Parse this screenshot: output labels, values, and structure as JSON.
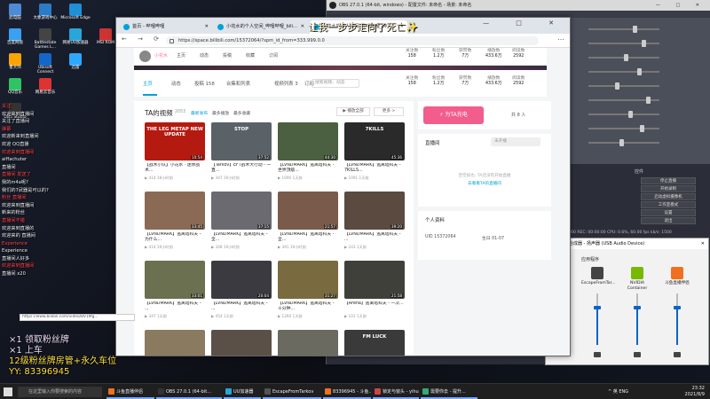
{
  "desktop": {
    "icons": [
      {
        "label": "此电脑",
        "color": "#4c8bd6"
      },
      {
        "label": "大象游戏中心",
        "color": "#2a7cc7"
      },
      {
        "label": "Microsoft Edge",
        "color": "#1f8fd6"
      },
      {
        "label": "百度网盘",
        "color": "#3aa0f0"
      },
      {
        "label": "Battlestate Games L...",
        "color": "#444"
      },
      {
        "label": "网易UU加速器",
        "color": "#2aa5d8"
      },
      {
        "label": "MSI ROM",
        "color": "#c33"
      },
      {
        "label": "鲁大师",
        "color": "#f9a400"
      },
      {
        "label": "Ubisoft Connect",
        "color": "#1467c9"
      },
      {
        "label": "迅雷",
        "color": "#2ca9ff"
      },
      {
        "label": "QQ音乐",
        "color": "#30c363"
      },
      {
        "label": "网易云音乐",
        "color": "#d33"
      },
      {
        "label": "OBS Studio",
        "color": "#333"
      }
    ]
  },
  "chat_overlay": {
    "lines": [
      "关注",
      "欢迎来到直播间",
      "关注了直播间",
      "弹幕",
      "欢迎新来到直播间",
      "欢迎 QQ直播",
      "欢迎来到直播间",
      "aiffachuter",
      "直播间",
      "直播间 发送了",
      "我的m4a呢?",
      "我们的7武器是可以的?",
      "粉丝 直播间",
      "欢迎来到直播间",
      "新来的粉丝",
      "直播间不错",
      "欢迎来到直播的",
      "欢迎来的 直播间",
      "Experience",
      "Experience",
      "直播间人好多",
      "欢迎来到直播间",
      "直播间 x20"
    ]
  },
  "stream_overlay": {
    "line1": "×1 领取粉丝牌",
    "line2": "×1 上车",
    "line3": "12级粉丝牌房管+永久车位",
    "line4": "YY: 83396945",
    "top_text": "让我一步步走向了死亡✨"
  },
  "obs": {
    "title": "OBS 27.0.1 (64-bit, windows) - 配置文件: 未命名 - 场景: 未命名",
    "controls_title": "控件",
    "controls": [
      "停止直播",
      "开始录制",
      "启动虚拟摄像机",
      "工作室模式",
      "设置",
      "退出"
    ],
    "status": "LIVE: 00:00:00   REC: 00:00:00   CPU: 0.6%, 60.00 fps     kb/s: 1500"
  },
  "volume_mixer": {
    "title": "音量合成器 - 扬声器 (USB Audio Device)",
    "section": "应用程序",
    "apps": [
      {
        "name": "EscapeFromTar...",
        "color": "#444",
        "level": 0.72
      },
      {
        "name": "NVIDIA Container",
        "color": "#76b900",
        "level": 0.72
      },
      {
        "name": "斗鱼直播伴侣",
        "color": "#f07020",
        "level": 0.72
      }
    ]
  },
  "browser": {
    "tabs": [
      {
        "label": "首页 - 哔哩哔哩",
        "active": false
      },
      {
        "label": "小花水的个人空间_哔哩哔哩_bili...",
        "active": false
      },
      {
        "label": "小花水的个人空间_哔哩哔哩_bili...",
        "active": true
      }
    ],
    "url": "https://space.bilibili.com/15372064/?spm_id_from=333.999.0.0",
    "status_url": "https://www.bilibili.com/video/BV1Mg..."
  },
  "bili": {
    "username": "小花水",
    "mini_nav": [
      "主页",
      "动态",
      "投稿",
      "收藏",
      "订阅"
    ],
    "mini_counts": [
      "168",
      "58",
      "8"
    ],
    "nav": [
      {
        "label": "主页",
        "active": true
      },
      {
        "label": "动态",
        "active": false
      },
      {
        "label": "投稿 158",
        "active": false
      },
      {
        "label": "合集和列表",
        "active": false
      },
      {
        "label": "视频列表 3",
        "active": false
      },
      {
        "label": "订阅",
        "active": false
      }
    ],
    "search_placeholder": "搜索视频、动态",
    "stats": [
      {
        "label": "关注数",
        "value": "158"
      },
      {
        "label": "粉丝数",
        "value": "1.2万"
      },
      {
        "label": "获赞数",
        "value": "7万"
      },
      {
        "label": "播放数",
        "value": "433.6万"
      },
      {
        "label": "阅读数",
        "value": "2592"
      }
    ],
    "videos_title": "TA的视频",
    "videos_count": "2053",
    "sort_tabs": [
      "最新发布",
      "最多播放",
      "最多收藏"
    ],
    "play_all": "▶ 播放全部",
    "more": "更多 >",
    "videos": [
      {
        "title": "【战术小队】小花水 · 迷你战术...",
        "bg": "#b41a10",
        "overlay": "THE LEG METAP NEW UPDATE",
        "dur": "10:54",
        "plays": "414",
        "date": "18小时前"
      },
      {
        "title": "【Tarkov】EFT战术大行动 - 一直...",
        "bg": "#5a6268",
        "overlay": "STOP",
        "dur": "37:52",
        "plays": "347",
        "date": "19小时前"
      },
      {
        "title": "【LVNDMARK】逃离塔科夫 - 世界顶级...",
        "bg": "#4a6040",
        "overlay": "",
        "dur": "44:30",
        "plays": "1090",
        "date": "1天前"
      },
      {
        "title": "【LVNDMARK】逃离塔科夫 - 7KILLS...",
        "bg": "#2a2a2a",
        "overlay": "7KILLS",
        "dur": "45:36",
        "plays": "1091",
        "date": "1天前"
      },
      {
        "title": "【LVNDMARK】逃离塔科夫 - 为什么...",
        "bg": "#8a6a55",
        "overlay": "",
        "dur": "33:45",
        "plays": "414",
        "date": "19小时前"
      },
      {
        "title": "【LVNDMARK】逃离塔科夫 - 全...",
        "bg": "#6a6a70",
        "overlay": "",
        "dur": "37:15",
        "plays": "348",
        "date": "19小时前"
      },
      {
        "title": "【LVNDMARK】逃离塔科夫 - 全...",
        "bg": "#7a5a4a",
        "overlay": "",
        "dur": "21:57",
        "plays": "391",
        "date": "19小时前"
      },
      {
        "title": "【LVNDMARK】逃离塔科夫 - ...",
        "bg": "#5a4a40",
        "overlay": "",
        "dur": "39:20",
        "plays": "243",
        "date": "1天前"
      },
      {
        "title": "【LVNDMARK】逃离塔科夫 - ...",
        "bg": "#6a7050",
        "overlay": "",
        "dur": "33:01",
        "plays": "347",
        "date": "1天前"
      },
      {
        "title": "【LVNDMARK】逃离塔科夫 - ...",
        "bg": "#3a3a40",
        "overlay": "",
        "dur": "20:04",
        "plays": "454",
        "date": "1天前"
      },
      {
        "title": "【LVNDMARK】逃离塔科夫 - 十分钟...",
        "bg": "#7a6a40",
        "overlay": "",
        "dur": "31:27",
        "plays": "1260",
        "date": "1天前"
      },
      {
        "title": "【Arena】逃离塔科夫 - 一次...",
        "bg": "#40403a",
        "overlay": "",
        "dur": "21:58",
        "plays": "103",
        "date": "1天前"
      },
      {
        "title": "",
        "bg": "#8a7a60",
        "overlay": "",
        "dur": "",
        "plays": "",
        "date": ""
      },
      {
        "title": "",
        "bg": "#5a5048",
        "overlay": "",
        "dur": "",
        "plays": "",
        "date": ""
      },
      {
        "title": "",
        "bg": "#6a6a60",
        "overlay": "",
        "dur": "",
        "plays": "",
        "date": ""
      },
      {
        "title": "",
        "bg": "#3a3a3a",
        "overlay": "FM LUCK",
        "dur": "",
        "plays": "",
        "date": ""
      }
    ],
    "charge_button": "⚡ 为TA充电",
    "fans_label": "共 8 人",
    "live_title": "直播间",
    "live_status": "未开播",
    "live_msg": "空空如也, TA还没有开始直播",
    "live_link": "去看看TA的直播间",
    "info_title": "个人资料",
    "uid": "UID   15372064",
    "birthday": "生日   01-07"
  },
  "taskbar": {
    "search": "在这里输入你要搜索的内容",
    "items": [
      {
        "label": "斗鱼直播伴侣",
        "color": "#f07020"
      },
      {
        "label": "OBS 27.0.1 (64-bit...",
        "color": "#333"
      },
      {
        "label": "UU加速器",
        "color": "#2aa5d8"
      },
      {
        "label": "EscapeFromTarkov",
        "color": "#555"
      },
      {
        "label": "83396945 - 斗鱼...",
        "color": "#f07020"
      },
      {
        "label": "锁定与窗头 - yihui...",
        "color": "#c44"
      },
      {
        "label": "需要你去 - 提升...",
        "color": "#3a7"
      }
    ],
    "tray": "^  英 ENG",
    "time": "23:32",
    "date": "2021/8/9"
  }
}
